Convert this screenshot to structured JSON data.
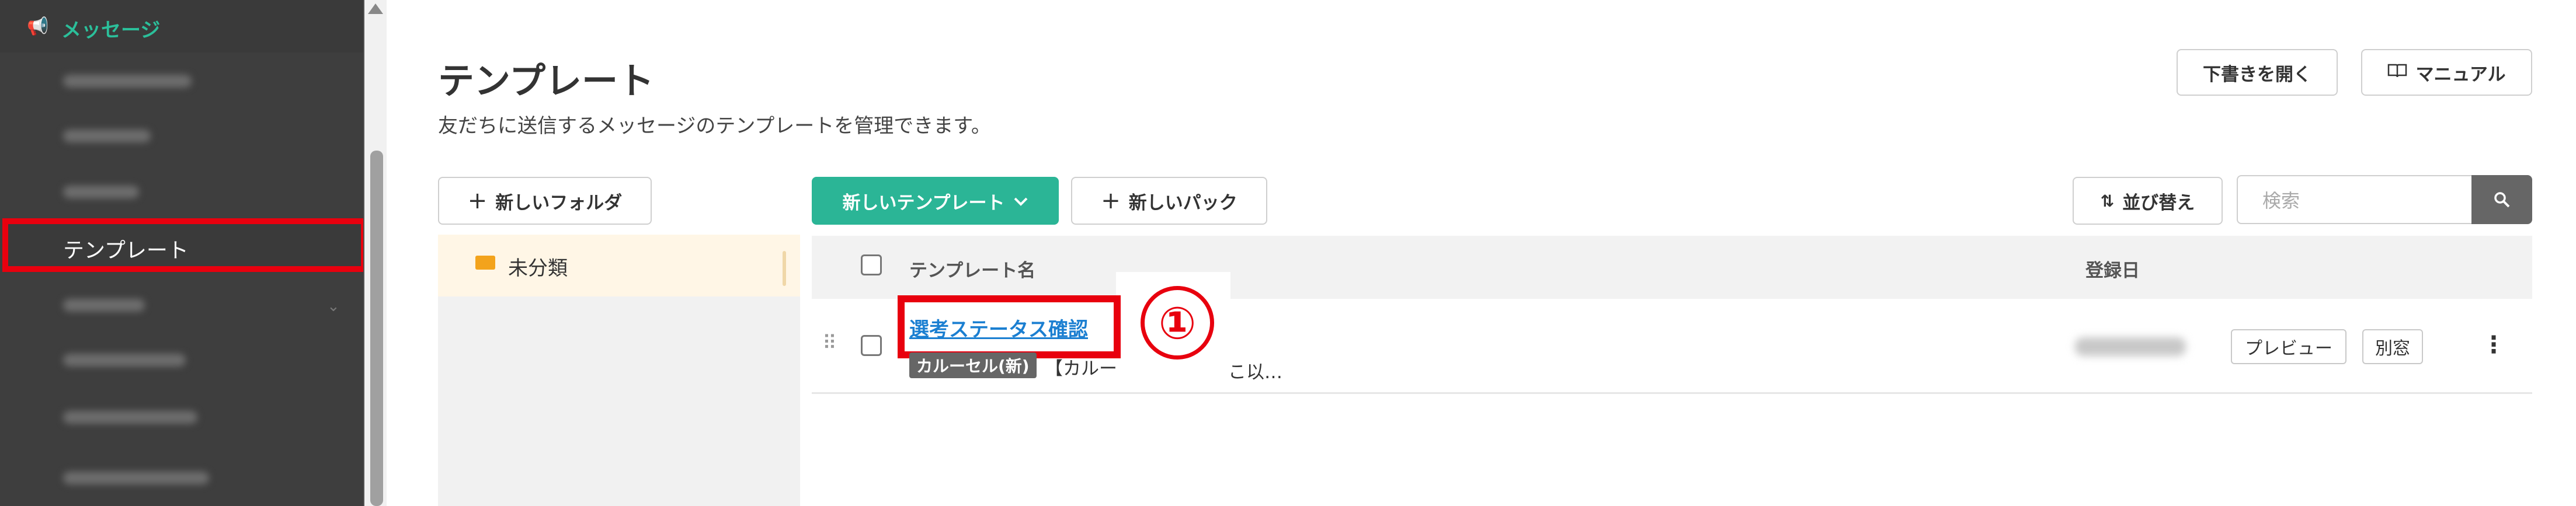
{
  "sidebar": {
    "section_icon": "megaphone-icon",
    "section_label": "メッセージ",
    "active_item": "テンプレート"
  },
  "page": {
    "title": "テンプレート",
    "subtitle": "友だちに送信するメッセージのテンプレートを管理できます。"
  },
  "header_buttons": {
    "open_drafts": "下書きを開く",
    "manual": "マニュアル",
    "manual_icon": "book-icon"
  },
  "toolbar": {
    "new_folder": "新しいフォルダ",
    "new_template": "新しいテンプレート",
    "new_pack": "新しいパック",
    "sort": "並び替え",
    "search_placeholder": "検索",
    "search_icon": "search-icon"
  },
  "folders": [
    {
      "label": "未分類",
      "icon": "folder-icon"
    }
  ],
  "table": {
    "columns": [
      "テンプレート名",
      "登録日"
    ],
    "rows": [
      {
        "name": "選考ステータス確認",
        "badge": "カルーセル(新)",
        "description_start": "【カルー",
        "description_end": "こ以…",
        "actions": [
          "プレビュー",
          "別窓"
        ]
      }
    ]
  },
  "annotation": {
    "step_number": "①",
    "accent_color": "#e8000e"
  },
  "colors": {
    "brand_green": "#2bb596",
    "link_blue": "#1b7fd1",
    "sidebar_bg": "#3e3e3e"
  }
}
